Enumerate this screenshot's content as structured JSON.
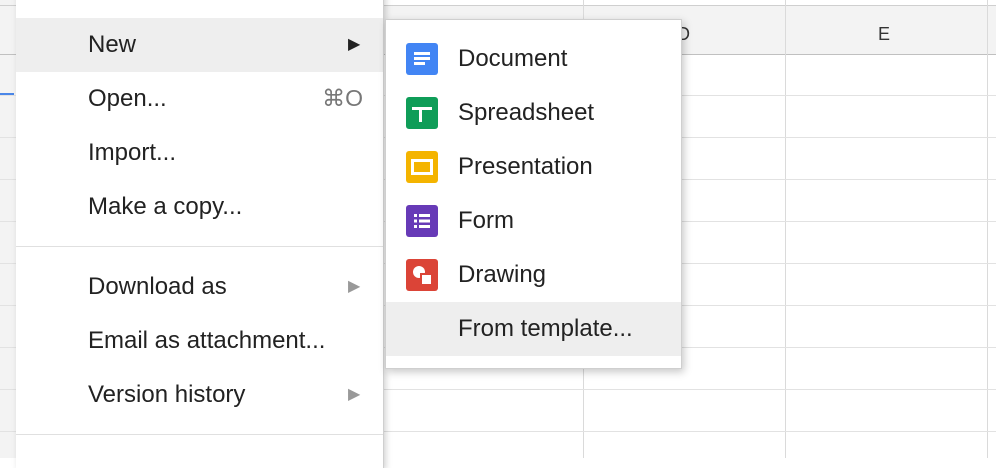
{
  "columns": {
    "d": "D",
    "e": "E"
  },
  "file_menu": {
    "new": "New",
    "open": "Open...",
    "open_shortcut": "⌘O",
    "import": "Import...",
    "make_copy": "Make a copy...",
    "download_as": "Download as",
    "email_attachment": "Email as attachment...",
    "version_history": "Version history"
  },
  "new_submenu": {
    "document": "Document",
    "spreadsheet": "Spreadsheet",
    "presentation": "Presentation",
    "form": "Form",
    "drawing": "Drawing",
    "from_template": "From template..."
  },
  "colors": {
    "docs": "#4285f4",
    "sheets": "#0f9d58",
    "slides": "#f4b400",
    "forms": "#673ab7",
    "drawings": "#db4437"
  },
  "icons": [
    "docs-icon",
    "sheets-icon",
    "slides-icon",
    "forms-icon",
    "drawings-icon",
    "submenu-arrow-icon"
  ]
}
